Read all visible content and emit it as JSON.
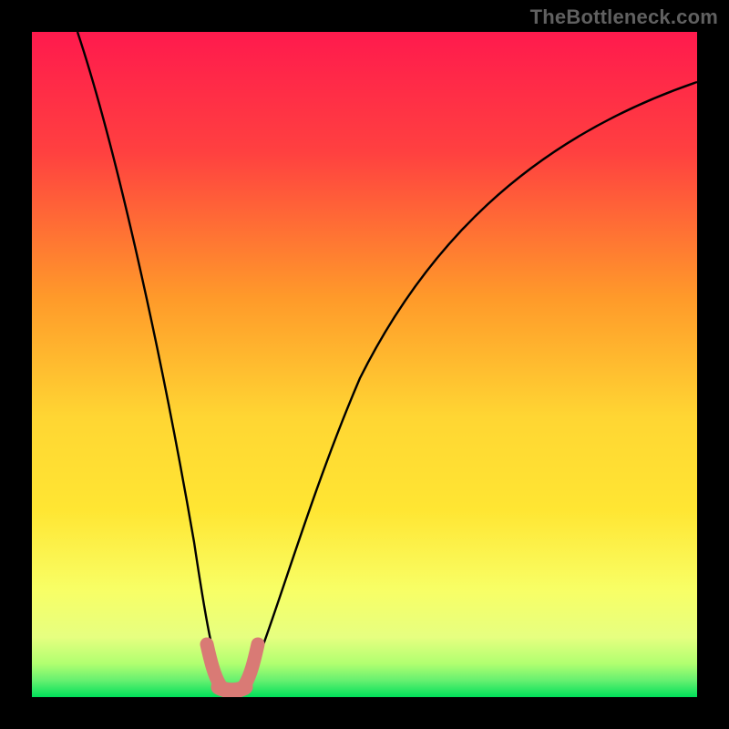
{
  "watermark": {
    "text": "TheBottleneck.com"
  },
  "chart_data": {
    "type": "line",
    "title": "",
    "xlabel": "",
    "ylabel": "",
    "xlim": [
      0,
      100
    ],
    "ylim": [
      0,
      100
    ],
    "background_gradient": {
      "top": "#ff1a4d",
      "upper_mid": "#ff9a2a",
      "mid": "#ffe633",
      "lower_mid": "#f8ff66",
      "near_bottom": "#d6ff66",
      "bottom": "#00e05a"
    },
    "series": [
      {
        "name": "bottleneck-curve",
        "color": "#000000",
        "x": [
          5,
          8,
          12,
          16,
          20,
          24,
          26,
          28,
          29,
          30,
          31,
          32,
          34,
          38,
          44,
          52,
          62,
          74,
          88,
          100
        ],
        "values": [
          100,
          86,
          70,
          55,
          41,
          26,
          17,
          8,
          3,
          1,
          1,
          3,
          8,
          20,
          36,
          52,
          66,
          78,
          88,
          95
        ]
      }
    ],
    "highlight": {
      "name": "min-region",
      "color": "#d97a75",
      "x": [
        27.5,
        28.5,
        29.0,
        30.0,
        31.0,
        32.0,
        33.0
      ],
      "values": [
        5.5,
        2.5,
        1.2,
        1.0,
        1.0,
        1.2,
        4.0
      ]
    }
  }
}
